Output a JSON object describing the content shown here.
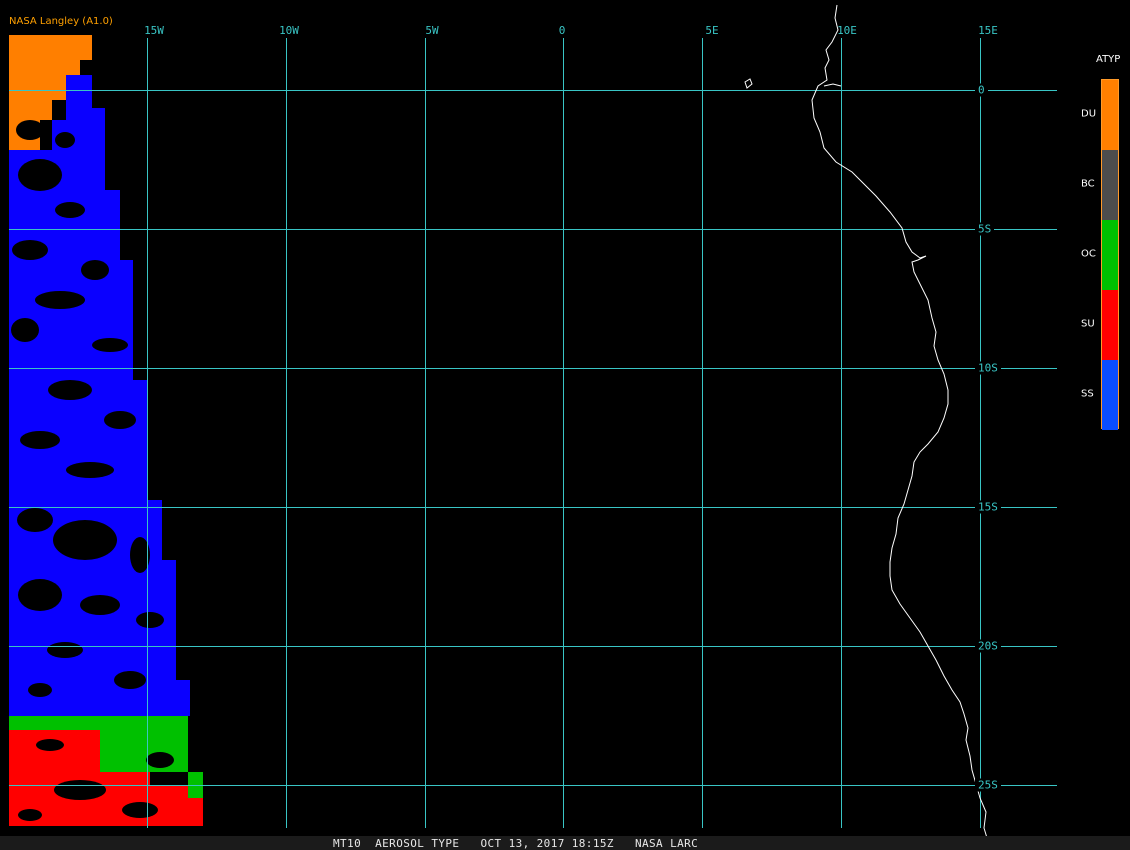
{
  "header": {
    "credit": "NASA Langley (A1.0)"
  },
  "map": {
    "longitude_labels": [
      "15W",
      "10W",
      "5W",
      "0",
      "5E",
      "10E",
      "15E"
    ],
    "latitude_labels": [
      "0",
      "5S",
      "10S",
      "15S",
      "20S",
      "25S"
    ],
    "grid_color": "#39c5c5",
    "coastline_color": "#ffffff"
  },
  "legend": {
    "title": "ATYP",
    "items": [
      {
        "label": "DU",
        "color": "#ff7f00"
      },
      {
        "label": "BC",
        "color": "#4d4d4d"
      },
      {
        "label": "OC",
        "color": "#00c000"
      },
      {
        "label": "SU",
        "color": "#ff0000"
      },
      {
        "label": "SS",
        "color": "#0a4dff"
      }
    ],
    "border_color": "#ff9a2a"
  },
  "footer": {
    "text": "MT10  AEROSOL TYPE   OCT 13, 2017 18:15Z   NASA LARC"
  }
}
